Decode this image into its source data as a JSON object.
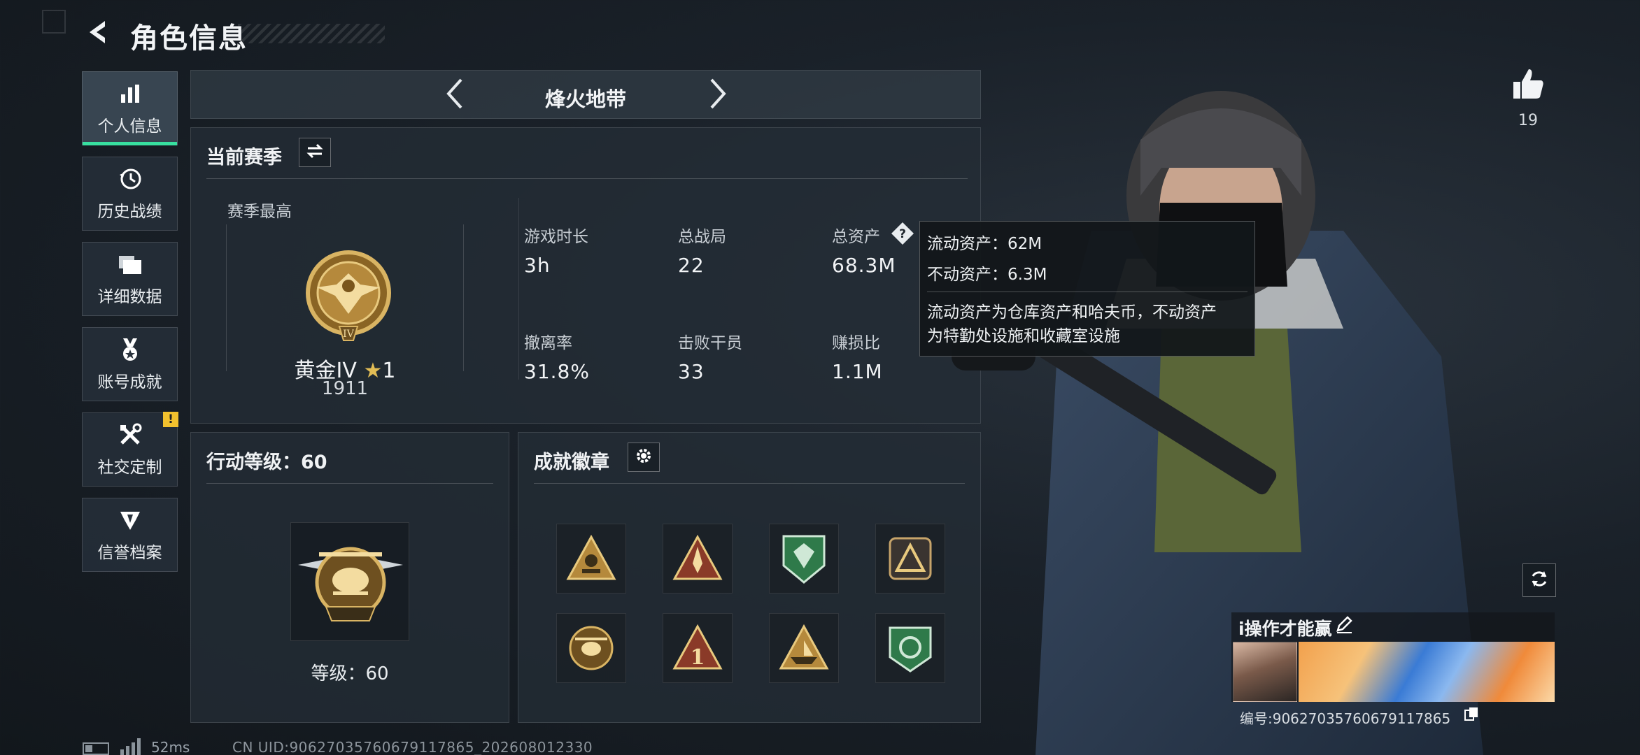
{
  "header": {
    "title": "角色信息"
  },
  "sidebar": {
    "items": [
      {
        "label": "个人信息",
        "icon": "bar-chart-icon",
        "active": true
      },
      {
        "label": "历史战绩",
        "icon": "history-clock-icon"
      },
      {
        "label": "详细数据",
        "icon": "folders-icon"
      },
      {
        "label": "账号成就",
        "icon": "medal-icon"
      },
      {
        "label": "社交定制",
        "icon": "tools-icon",
        "badge": "!"
      },
      {
        "label": "信誉档案",
        "icon": "shield-wing-icon"
      }
    ]
  },
  "mode_bar": {
    "mode": "烽火地带"
  },
  "season_panel": {
    "title": "当前赛季",
    "best_label": "赛季最高",
    "rank_name": "黄金IV",
    "rank_stars": "1",
    "rank_score": "1911",
    "stats": [
      {
        "label": "游戏时长",
        "value": "3h"
      },
      {
        "label": "总战局",
        "value": "22"
      },
      {
        "label": "总资产",
        "value": "68.3M"
      },
      {
        "label": "撤离率",
        "value": "31.8%"
      },
      {
        "label": "击败干员",
        "value": "33"
      },
      {
        "label": "赚损比",
        "value": "1.1M"
      }
    ]
  },
  "tooltip": {
    "line1": "流动资产：62M",
    "line2": "不动资产：6.3M",
    "desc1": "流动资产为仓库资产和哈夫币，不动资产",
    "desc2": "为特勤处设施和收藏室设施"
  },
  "action_level": {
    "title": "行动等级：60",
    "level_label": "等级：60"
  },
  "achievements": {
    "title": "成就徽章",
    "badges": [
      "rescue-badge-icon",
      "rocket-badge-icon",
      "green-shield-badge-icon",
      "triangle-badge-icon",
      "helicopter-badge-icon",
      "number-one-badge-icon",
      "ship-badge-icon",
      "green-medal-badge-icon"
    ]
  },
  "profile": {
    "likes": "19",
    "player_name": "i操作才能赢",
    "serial": "编号:9062703576067911786​5"
  },
  "footer": {
    "ping": "52ms",
    "uid": "CN UID:9062703576067911786​5_202608012330"
  },
  "colors": {
    "accent": "#38e0a0",
    "warning": "#f2c12e",
    "gold": "#c9a04a"
  }
}
